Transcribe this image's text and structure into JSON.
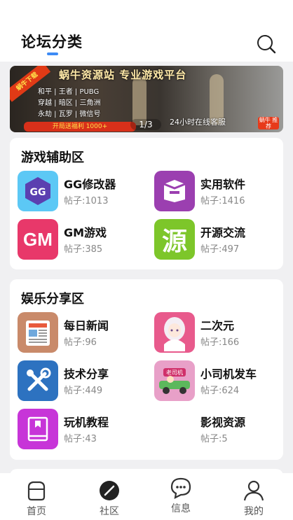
{
  "header": {
    "title": "论坛分类"
  },
  "banner": {
    "ribbon": "蜗牛下载",
    "headline": "蜗牛资源站 专业游戏平台",
    "tags": [
      "和平 | 王者 | PUBG",
      "穿越 | 暗区 | 三角洲",
      "永劫 | 瓦罗 | 微信号"
    ],
    "strip": "开局送福利 1000+",
    "sub": "24小时在线客服",
    "badge": "蜗牛 推荐",
    "pager": "1/3"
  },
  "sections": [
    {
      "title": "游戏辅助区",
      "items": [
        {
          "name": "GG修改器",
          "count": "帖子:1013",
          "icon": "gg-modifier-icon"
        },
        {
          "name": "实用软件",
          "count": "帖子:1416",
          "icon": "box-icon"
        },
        {
          "name": "GM游戏",
          "count": "帖子:385",
          "icon": "gm-icon"
        },
        {
          "name": "开源交流",
          "count": "帖子:497",
          "icon": "yuan-icon"
        }
      ]
    },
    {
      "title": "娱乐分享区",
      "items": [
        {
          "name": "每日新闻",
          "count": "帖子:96",
          "icon": "newspaper-icon"
        },
        {
          "name": "二次元",
          "count": "帖子:166",
          "icon": "anime-girl-icon"
        },
        {
          "name": "技术分享",
          "count": "帖子:449",
          "icon": "tools-icon"
        },
        {
          "name": "小司机发车",
          "count": "帖子:624",
          "icon": "car-cartoon-icon"
        },
        {
          "name": "玩机教程",
          "count": "帖子:43",
          "icon": "book-icon"
        },
        {
          "name": "影视资源",
          "count": "帖子:5",
          "icon": ""
        }
      ]
    }
  ],
  "icon_text": {
    "gm": "GM",
    "yuan": "源",
    "gg": "GG",
    "car": "老司机"
  },
  "tabs": [
    {
      "label": "首页",
      "icon": "home-icon"
    },
    {
      "label": "社区",
      "icon": "compass-icon"
    },
    {
      "label": "信息",
      "icon": "message-icon"
    },
    {
      "label": "我的",
      "icon": "user-icon"
    }
  ],
  "colors": {
    "accent": "#3d8bf5",
    "gg_bg": "#5cc8f5",
    "box_bg": "#9b3fb0",
    "gm_bg": "#e8386a",
    "yuan_bg": "#7dc62a",
    "news_bg": "#c98a6a",
    "anime_bg": "#e85a8c",
    "tools_bg": "#2d72c0",
    "car_bg": "#e8a0c8",
    "book_bg": "#c735d8"
  }
}
